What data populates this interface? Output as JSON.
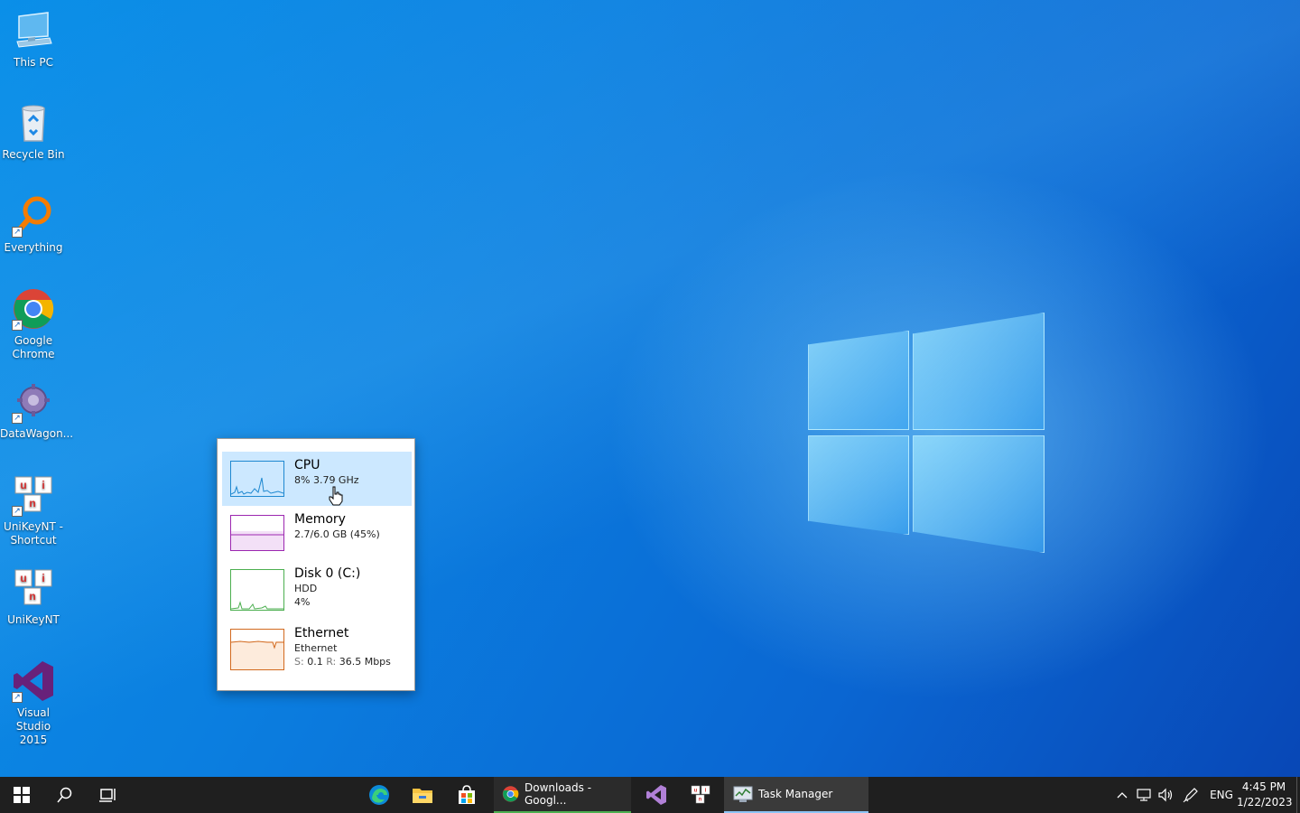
{
  "desktop": {
    "icons": [
      {
        "label": "This PC",
        "icon": "computer-icon"
      },
      {
        "label": "Recycle Bin",
        "icon": "recycle-bin-icon"
      },
      {
        "label": "Everything",
        "icon": "everything-search-icon"
      },
      {
        "label": "Google\nChrome",
        "icon": "chrome-icon"
      },
      {
        "label": "DataWagon...",
        "icon": "datawagon-icon"
      },
      {
        "label": "UniKeyNT -\nShortcut",
        "icon": "unikey-icon"
      },
      {
        "label": "UniKeyNT",
        "icon": "unikey-icon"
      },
      {
        "label": "Visual Studio\n2015",
        "icon": "visual-studio-icon"
      }
    ]
  },
  "flyout": {
    "items": [
      {
        "title": "CPU",
        "line1": "8% 3.79 GHz",
        "line2": "",
        "color": "#1e88d0"
      },
      {
        "title": "Memory",
        "line1": "2.7/6.0 GB (45%)",
        "line2": "",
        "color": "#9c27b0"
      },
      {
        "title": "Disk 0 (C:)",
        "line1": "HDD",
        "line2": "4%",
        "color": "#4caf50"
      },
      {
        "title": "Ethernet",
        "line1": "Ethernet",
        "line2_s": "S:",
        "line2_sv": "0.1",
        "line2_r": "R:",
        "line2_rv": "36.5 Mbps",
        "color": "#d2691e"
      }
    ]
  },
  "taskbar": {
    "apps": [
      {
        "label": "Downloads - Googl...",
        "icon": "chrome-icon"
      },
      {
        "label": "Task Manager",
        "icon": "task-manager-icon"
      }
    ],
    "tray": {
      "language": "ENG",
      "time": "4:45 PM",
      "date": "1/22/2023"
    }
  },
  "colors": {
    "taskbar_bg": "#1f1f1f",
    "selection": "#cce8ff",
    "accent": "#8cc4f5"
  }
}
